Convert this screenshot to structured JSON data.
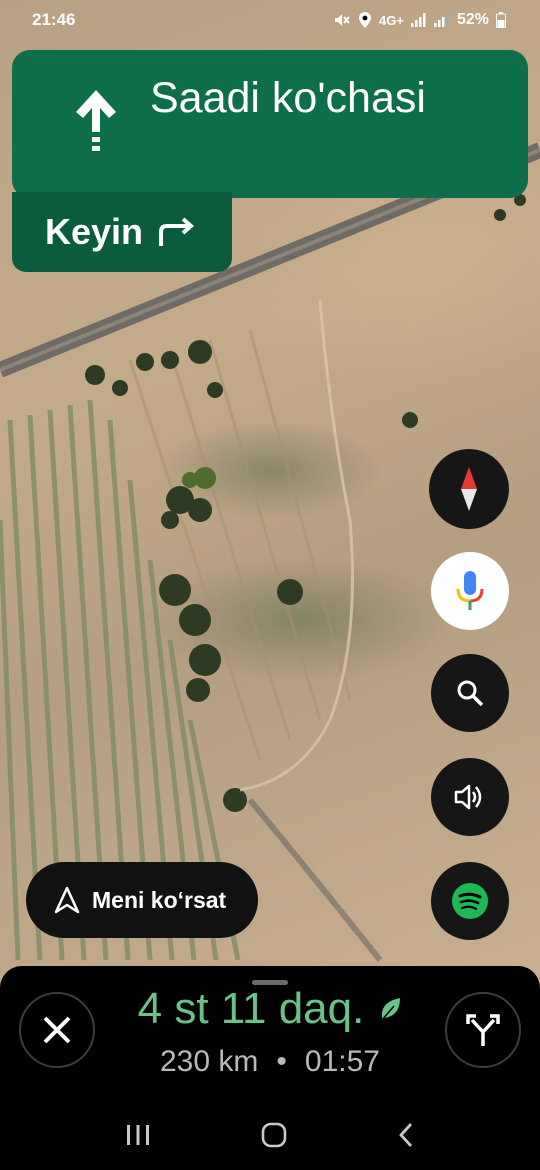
{
  "status_bar": {
    "time": "21:46",
    "network": "4G+",
    "battery": "52%"
  },
  "navigation": {
    "direction_icon": "arrow-up-icon",
    "street_name": "Saadi ko'chasi",
    "then_label": "Keyin",
    "then_icon": "turn-right-icon",
    "banner_color": "#0e6e49"
  },
  "map_controls": {
    "compass": "compass-icon",
    "voice": "microphone-icon",
    "search": "search-icon",
    "sound": "volume-icon",
    "music": "spotify-icon"
  },
  "recenter": {
    "label": "Meni ko‘rsat",
    "icon": "navigation-arrow-icon"
  },
  "trip_sheet": {
    "eta": "4 st 11 daq.",
    "eco_icon": "leaf-icon",
    "distance": "230 km",
    "separator": "•",
    "arrival_time": "01:57",
    "eta_color": "#69c28a",
    "close_icon": "close-icon",
    "routes_icon": "alternate-routes-icon"
  },
  "system_nav": {
    "recents": "recents-icon",
    "home": "home-icon",
    "back": "back-icon"
  }
}
